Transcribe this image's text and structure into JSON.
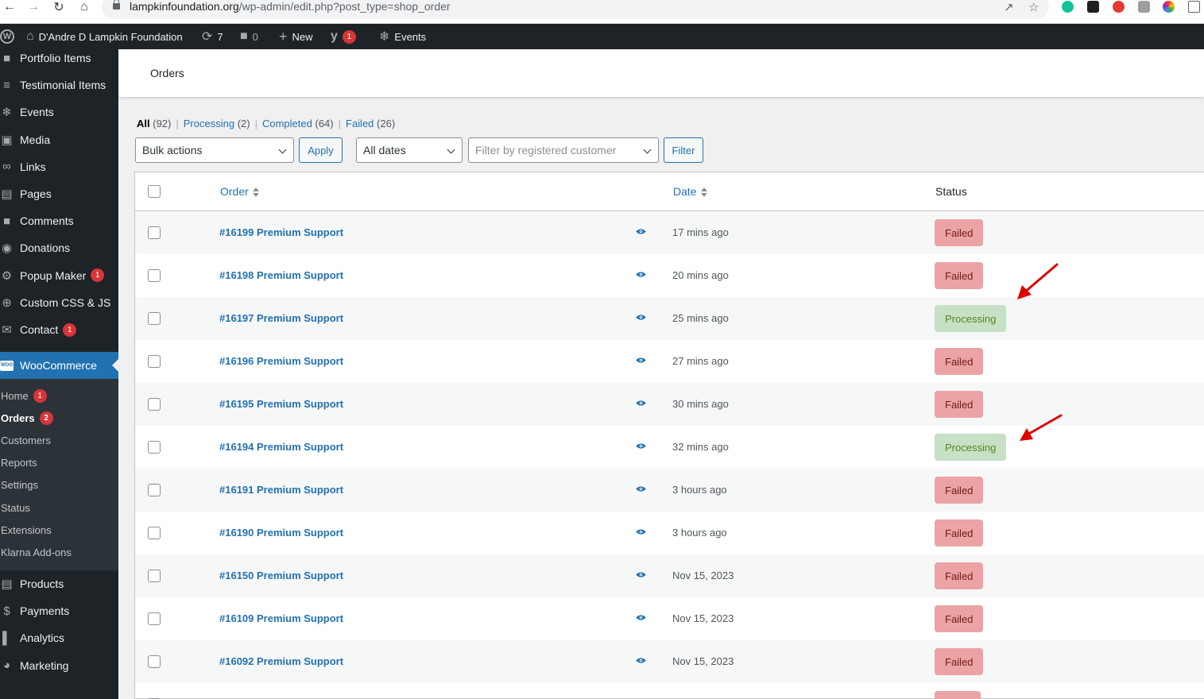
{
  "browser": {
    "url_domain": "lampkinfoundation.org",
    "url_path": "/wp-admin/edit.php?post_type=shop_order"
  },
  "adminbar": {
    "site_name": "D'Andre D Lampkin Foundation",
    "updates_count": "7",
    "comments_count": "0",
    "new_label": "New",
    "yoast_badge": "1",
    "events_label": "Events"
  },
  "sidebar": {
    "top_items": [
      {
        "label": "Portfolio Items",
        "icon": "portfolio-icon"
      },
      {
        "label": "Testimonial Items",
        "icon": "testimonial-icon"
      },
      {
        "label": "Events",
        "icon": "events-icon"
      },
      {
        "label": "Media",
        "icon": "media-icon"
      },
      {
        "label": "Links",
        "icon": "links-icon"
      },
      {
        "label": "Pages",
        "icon": "pages-icon"
      },
      {
        "label": "Comments",
        "icon": "comments-icon"
      },
      {
        "label": "Donations",
        "icon": "donations-icon"
      },
      {
        "label": "Popup Maker",
        "icon": "popup-icon",
        "badge": "1"
      },
      {
        "label": "Custom CSS & JS",
        "icon": "plus-circle-icon"
      },
      {
        "label": "Contact",
        "icon": "mail-icon",
        "badge": "1"
      }
    ],
    "woocommerce_label": "WooCommerce",
    "woocommerce_icon_text": "WOO",
    "submenu": [
      {
        "label": "Home",
        "badge": "1"
      },
      {
        "label": "Orders",
        "badge": "2",
        "current": true
      },
      {
        "label": "Customers"
      },
      {
        "label": "Reports"
      },
      {
        "label": "Settings"
      },
      {
        "label": "Status"
      },
      {
        "label": "Extensions"
      },
      {
        "label": "Klarna Add-ons"
      }
    ],
    "bottom_items": [
      {
        "label": "Products",
        "icon": "products-icon"
      },
      {
        "label": "Payments",
        "icon": "payments-icon"
      },
      {
        "label": "Analytics",
        "icon": "analytics-icon"
      },
      {
        "label": "Marketing",
        "icon": "marketing-icon"
      }
    ]
  },
  "page": {
    "title": "Orders"
  },
  "filters": {
    "all_label": "All",
    "all_count": "(92)",
    "processing_label": "Processing",
    "processing_count": "(2)",
    "completed_label": "Completed",
    "completed_count": "(64)",
    "failed_label": "Failed",
    "failed_count": "(26)"
  },
  "controls": {
    "bulk_actions": "Bulk actions",
    "apply": "Apply",
    "all_dates": "All dates",
    "customer_placeholder": "Filter by registered customer",
    "filter": "Filter"
  },
  "table": {
    "col_order": "Order",
    "col_date": "Date",
    "col_status": "Status",
    "rows": [
      {
        "order": "#16199 Premium Support",
        "date": "17 mins ago",
        "status": "Failed"
      },
      {
        "order": "#16198 Premium Support",
        "date": "20 mins ago",
        "status": "Failed"
      },
      {
        "order": "#16197 Premium Support",
        "date": "25 mins ago",
        "status": "Processing"
      },
      {
        "order": "#16196 Premium Support",
        "date": "27 mins ago",
        "status": "Failed"
      },
      {
        "order": "#16195 Premium Support",
        "date": "30 mins ago",
        "status": "Failed"
      },
      {
        "order": "#16194 Premium Support",
        "date": "32 mins ago",
        "status": "Processing"
      },
      {
        "order": "#16191 Premium Support",
        "date": "3 hours ago",
        "status": "Failed"
      },
      {
        "order": "#16190 Premium Support",
        "date": "3 hours ago",
        "status": "Failed"
      },
      {
        "order": "#16150 Premium Support",
        "date": "Nov 15, 2023",
        "status": "Failed"
      },
      {
        "order": "#16109 Premium Support",
        "date": "Nov 15, 2023",
        "status": "Failed"
      },
      {
        "order": "#16092 Premium Support",
        "date": "Nov 15, 2023",
        "status": "Failed"
      },
      {
        "order": "",
        "date": "",
        "status": ""
      }
    ]
  },
  "colors": {
    "admin_dark": "#1d2327",
    "accent_blue": "#2271b1",
    "failed_bg": "#eba3a3",
    "failed_text": "#761919",
    "processing_bg": "#c6e1c6",
    "processing_text": "#5b841b",
    "annotation_red": "#e00000"
  }
}
